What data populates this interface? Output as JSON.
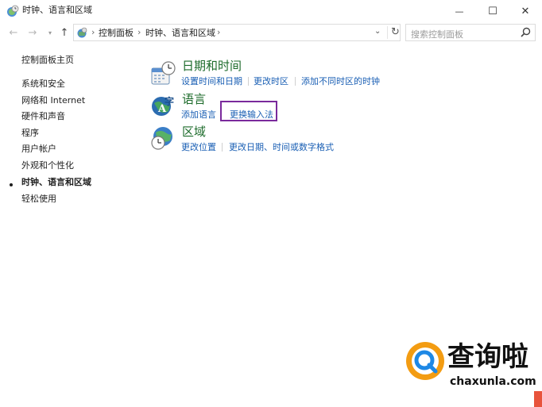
{
  "window": {
    "title": "时钟、语言和区域",
    "min_glyph": "—",
    "max_glyph": "☐",
    "close_glyph": "✕"
  },
  "nav": {
    "back_glyph": "←",
    "forward_glyph": "→",
    "recent_glyph": "▾",
    "up_glyph": "↑",
    "breadcrumb": [
      "控制面板",
      "时钟、语言和区域"
    ],
    "separator": "›",
    "dropdown_glyph": "⌄",
    "refresh_glyph": "↻"
  },
  "search": {
    "placeholder": "搜索控制面板"
  },
  "sidebar": {
    "home": "控制面板主页",
    "items": [
      "系统和安全",
      "网络和 Internet",
      "硬件和声音",
      "程序",
      "用户帐户",
      "外观和个性化",
      "时钟、语言和区域",
      "轻松使用"
    ],
    "active_index": 6
  },
  "categories": [
    {
      "title": "日期和时间",
      "icon": "clock-calendar-icon",
      "links": [
        "设置时间和日期",
        "更改时区",
        "添加不同时区的时钟"
      ]
    },
    {
      "title": "语言",
      "icon": "language-globe-icon",
      "links": [
        "添加语言",
        "更换输入法"
      ]
    },
    {
      "title": "区域",
      "icon": "region-globe-clock-icon",
      "links": [
        "更改位置",
        "更改日期、时间或数字格式"
      ]
    }
  ],
  "highlight": {
    "target": "更换输入法",
    "color": "#7a2a9c"
  },
  "watermark": {
    "brand": "查询啦",
    "domain": "chaxunla.com"
  },
  "colors": {
    "category_title": "#1d6b2b",
    "link": "#1a5fb4",
    "logo_orange": "#f39c12",
    "logo_blue": "#1e88e5"
  }
}
